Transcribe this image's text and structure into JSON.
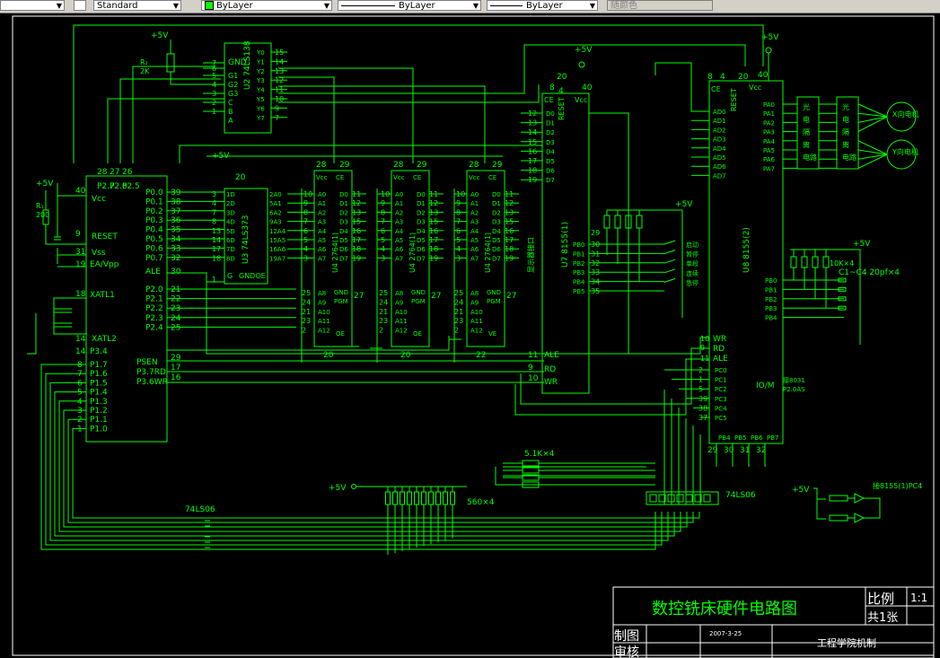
{
  "toolbar": {
    "text_style": "Standard",
    "layer": "ByLayer",
    "linetype": "ByLayer",
    "lineweight": "ByLayer",
    "plot_style": "随颜色"
  },
  "title_block": {
    "title": "数控铣床硬件电路图",
    "scale_label": "比例",
    "scale_value": "1:1",
    "sheets": "共1张",
    "drawn_label": "制图",
    "checked_label": "审核",
    "date": "2007-3-25",
    "organization": "工程学院机制"
  },
  "power": {
    "vcc": "+5V"
  },
  "chips": {
    "cpu": {
      "pins_p0": [
        "P0.0",
        "P0.1",
        "P0.2",
        "P0.3",
        "P0.4",
        "P0.5",
        "P0.6",
        "P0.7"
      ],
      "pins_p0_num": [
        "39",
        "38",
        "37",
        "36",
        "35",
        "34",
        "33",
        "32"
      ],
      "pins_p2": [
        "P2.0",
        "P2.1",
        "P2.2",
        "P2.3",
        "P2.4"
      ],
      "pins_p2_num": [
        "21",
        "22",
        "23",
        "24",
        "25"
      ],
      "pins_p1": [
        "P1.7",
        "P1.6",
        "P1.5",
        "P1.4",
        "P1.3",
        "P1.2",
        "P1.1",
        "P1.0"
      ],
      "pins_p1_num": [
        "8",
        "7",
        "6",
        "5",
        "4",
        "3",
        "2",
        "1"
      ],
      "reset": "RESET",
      "vcc": "Vcc",
      "vss": "Vss",
      "ea": "EA/Vpp",
      "ale": "ALE",
      "xtal1": "XATL1",
      "xtal2": "XATL2",
      "p34": "P3.4",
      "psen": "PSEN",
      "p37": "P3.7RD",
      "p36": "P3.6WR",
      "top_pins": [
        "P2.7",
        "P2.6",
        "P2.5"
      ],
      "top_nums": [
        "28",
        "27",
        "26"
      ]
    },
    "u2": {
      "name": "U2 74LS138",
      "gnd": "GND",
      "inputs": [
        "G1",
        "G2",
        "G3",
        "C",
        "B",
        "A"
      ],
      "outputs": [
        "Y0",
        "Y1",
        "Y2",
        "Y3",
        "Y4",
        "Y5",
        "Y6",
        "Y7"
      ]
    },
    "u3": {
      "name": "U3 74LS373",
      "inputs": [
        "1D",
        "2D",
        "3D",
        "4D",
        "5D",
        "6D",
        "7D",
        "8D"
      ],
      "outputs": [
        "2A0",
        "5A1",
        "6A2",
        "9A3",
        "12A4",
        "15A5",
        "16A6",
        "19A7"
      ],
      "g": "G",
      "gnd_oe": "GNDOE"
    },
    "eprom": {
      "name": "2764(1)",
      "addr": [
        "A0",
        "A1",
        "A2",
        "A3",
        "A4",
        "A5",
        "A6",
        "A7"
      ],
      "data": [
        "D0",
        "D1",
        "D2",
        "D3",
        "D4",
        "D5",
        "D6",
        "D7"
      ],
      "lower": [
        "A8",
        "A9",
        "A10",
        "A11",
        "A12"
      ]
    },
    "u7": {
      "name": "U7 8155(1)",
      "pb": [
        "PB0",
        "PB1",
        "PB2",
        "PB3",
        "PB4",
        "PB5"
      ],
      "side_label": "显示器接口",
      "switch_labels": [
        "启动",
        "暂停",
        "单段",
        "连续",
        "急停"
      ]
    },
    "u8": {
      "name": "U8 8155(2)",
      "pa": [
        "PA0",
        "PA1",
        "PA2",
        "PA3",
        "PA4",
        "PA5",
        "PA6",
        "PA7"
      ],
      "io": "IO/M",
      "note": "接8031 P2.0AS"
    },
    "opto": {
      "label": "光电隔离电路"
    },
    "motors": [
      "X向电机",
      "Y向电机"
    ],
    "resistors": {
      "r1": "R1\n200",
      "r2": "R2\n2K",
      "bank": "10K×4",
      "caps": "C1~C4 20pf×4",
      "bus": "5.1K×4",
      "leds": "560×4"
    },
    "drivers": [
      "74LS06",
      "74LS06"
    ],
    "pc4_note": "接8155(1)PC4"
  }
}
